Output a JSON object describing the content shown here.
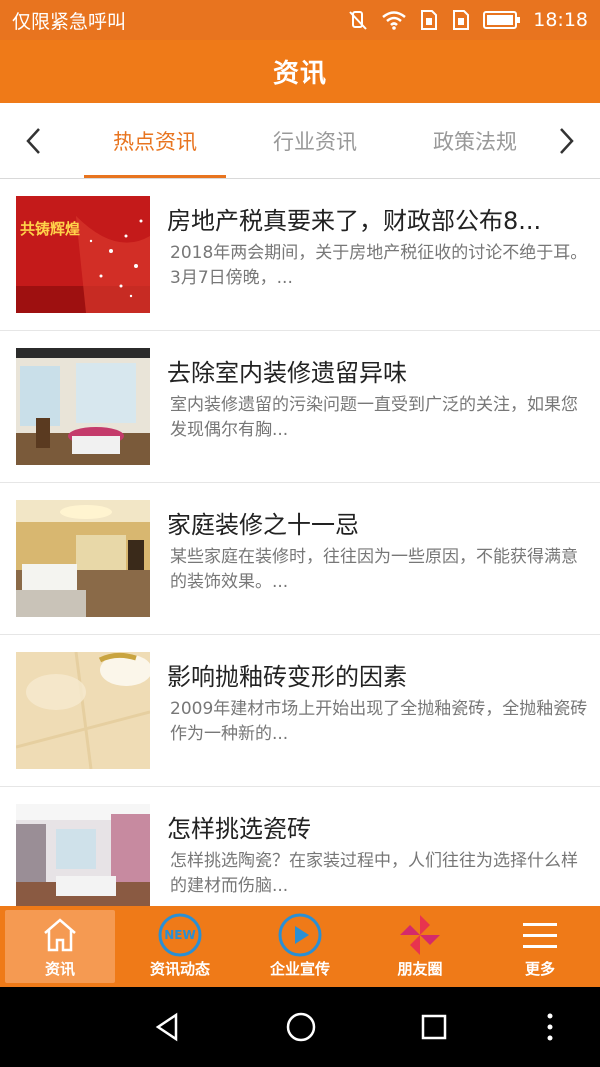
{
  "status_bar": {
    "carrier_text": "仅限紧急呼叫",
    "time": "18:18",
    "icons": [
      "vibrate-off-icon",
      "wifi-icon",
      "sim1-icon",
      "sim2-icon",
      "battery-icon"
    ]
  },
  "header": {
    "title": "资讯"
  },
  "tabs": [
    {
      "label": "热点资讯",
      "active": true
    },
    {
      "label": "行业资讯",
      "active": false
    },
    {
      "label": "政策法规",
      "active": false
    }
  ],
  "news": [
    {
      "title": "房地产税真要来了，财政部公布8...",
      "summary": "2018年两会期间，关于房地产税征收的讨论不绝于耳。3月7日傍晚，...",
      "thumb_caption": "共铸辉煌"
    },
    {
      "title": "去除室内装修遗留异味",
      "summary": "室内装修遗留的污染问题一直受到广泛的关注，如果您发现偶尔有胸..."
    },
    {
      "title": "家庭装修之十一忌",
      "summary": "某些家庭在装修时，往往因为一些原因，不能获得满意的装饰效果。..."
    },
    {
      "title": "影响抛釉砖变形的因素",
      "summary": "2009年建材市场上开始出现了全抛釉瓷砖，全抛釉瓷砖作为一种新的..."
    },
    {
      "title": "怎样挑选瓷砖",
      "summary": "怎样挑选陶瓷？在家装过程中，人们往往为选择什么样的建材而伤脑..."
    }
  ],
  "bottom_nav": [
    {
      "label": "资讯",
      "icon": "home-icon",
      "active": true
    },
    {
      "label": "资讯动态",
      "icon": "new-badge-icon",
      "badge_text": "NEW",
      "active": false
    },
    {
      "label": "企业宣传",
      "icon": "play-icon",
      "active": false
    },
    {
      "label": "朋友圈",
      "icon": "pinwheel-icon",
      "active": false
    },
    {
      "label": "更多",
      "icon": "menu-icon",
      "active": false
    }
  ],
  "colors": {
    "brand": "#ef7a18",
    "status_bar": "#e8741f",
    "tab_active": "#e8741f",
    "nav_active_bg": "#f59a52",
    "new_badge": "#2a8fd4",
    "play_icon": "#2a8fd4",
    "pinwheel": "#e8344e"
  }
}
